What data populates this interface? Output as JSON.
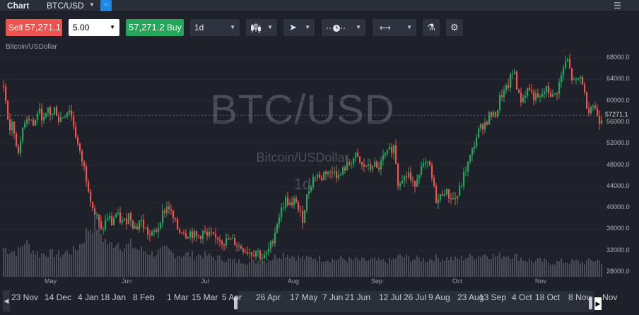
{
  "app": {
    "title": "Chart",
    "symbol": "BTC/USD"
  },
  "toolbar": {
    "sell_label": "Sell",
    "sell_price": "57,271.1",
    "quantity": "5.00",
    "buy_price": "57,271.2",
    "buy_label": "Buy",
    "interval": "1d"
  },
  "pair_label": "Bitcoin/USDollar",
  "watermark": {
    "symbol": "BTC/USD",
    "name": "Bitcoin/USDollar",
    "interval": "1d"
  },
  "colors": {
    "up": "#26a65b",
    "down": "#ef5350",
    "volume": "#4a4d55",
    "background": "#1e2129"
  },
  "last_price": "57271.1",
  "navigator_labels": [
    "23 Nov",
    "14 Dec",
    "4 Jan",
    "18 Jan",
    "8 Feb",
    "1 Mar",
    "15 Mar",
    "5 Apr",
    "26 Apr",
    "17 May",
    "7 Jun",
    "21 Jun",
    "12 Jul",
    "26 Jul",
    "9 Aug",
    "23 Aug",
    "13 Sep",
    "4 Oct",
    "18 Oct",
    "8 Nov",
    "Nov"
  ],
  "chart_data": {
    "type": "candlestick",
    "x_tick_labels": [
      "May",
      "Jun",
      "Jul",
      "Aug",
      "Sep",
      "Oct",
      "Nov"
    ],
    "y_tick_labels": [
      "68000.0",
      "64000.0",
      "60000.0",
      "56000.0",
      "52000.0",
      "48000.0",
      "44000.0",
      "40000.0",
      "36000.0",
      "32000.0",
      "28000.0"
    ],
    "ylim": [
      28000,
      70000
    ],
    "close_series": [
      {
        "t": 0,
        "v": 62800
      },
      {
        "t": 4,
        "v": 59000
      },
      {
        "t": 8,
        "v": 54500
      },
      {
        "t": 13,
        "v": 55500
      },
      {
        "t": 18,
        "v": 51800
      },
      {
        "t": 23,
        "v": 50500
      },
      {
        "t": 28,
        "v": 56000
      },
      {
        "t": 33,
        "v": 57000
      },
      {
        "t": 38,
        "v": 56800
      },
      {
        "t": 43,
        "v": 55000
      },
      {
        "t": 48,
        "v": 58000
      },
      {
        "t": 53,
        "v": 57500
      },
      {
        "t": 58,
        "v": 56000
      },
      {
        "t": 63,
        "v": 58500
      },
      {
        "t": 68,
        "v": 57000
      },
      {
        "t": 73,
        "v": 58800
      },
      {
        "t": 78,
        "v": 56500
      },
      {
        "t": 83,
        "v": 57000
      },
      {
        "t": 88,
        "v": 57800
      },
      {
        "t": 93,
        "v": 58500
      },
      {
        "t": 98,
        "v": 56000
      },
      {
        "t": 103,
        "v": 53000
      },
      {
        "t": 108,
        "v": 50000
      },
      {
        "t": 113,
        "v": 48000
      },
      {
        "t": 118,
        "v": 45000
      },
      {
        "t": 123,
        "v": 42000
      },
      {
        "t": 128,
        "v": 39000
      },
      {
        "t": 133,
        "v": 38000
      },
      {
        "t": 138,
        "v": 35500
      },
      {
        "t": 143,
        "v": 37000
      },
      {
        "t": 148,
        "v": 38500
      },
      {
        "t": 153,
        "v": 37000
      },
      {
        "t": 158,
        "v": 39000
      },
      {
        "t": 163,
        "v": 38000
      },
      {
        "t": 168,
        "v": 37200
      },
      {
        "t": 173,
        "v": 37500
      },
      {
        "t": 178,
        "v": 39000
      },
      {
        "t": 183,
        "v": 37000
      },
      {
        "t": 188,
        "v": 36000
      },
      {
        "t": 193,
        "v": 38000
      },
      {
        "t": 198,
        "v": 36500
      },
      {
        "t": 203,
        "v": 35500
      },
      {
        "t": 208,
        "v": 34500
      },
      {
        "t": 213,
        "v": 35500
      },
      {
        "t": 218,
        "v": 36000
      },
      {
        "t": 223,
        "v": 38500
      },
      {
        "t": 228,
        "v": 39500
      },
      {
        "t": 233,
        "v": 40500
      },
      {
        "t": 238,
        "v": 38500
      },
      {
        "t": 243,
        "v": 37000
      },
      {
        "t": 248,
        "v": 35500
      },
      {
        "t": 253,
        "v": 36000
      },
      {
        "t": 258,
        "v": 35000
      },
      {
        "t": 263,
        "v": 35500
      },
      {
        "t": 268,
        "v": 35000
      },
      {
        "t": 273,
        "v": 34500
      },
      {
        "t": 278,
        "v": 34800
      },
      {
        "t": 283,
        "v": 35500
      },
      {
        "t": 288,
        "v": 34500
      },
      {
        "t": 293,
        "v": 35000
      },
      {
        "t": 298,
        "v": 34000
      },
      {
        "t": 303,
        "v": 34500
      },
      {
        "t": 308,
        "v": 34000
      },
      {
        "t": 313,
        "v": 33500
      },
      {
        "t": 318,
        "v": 34000
      },
      {
        "t": 323,
        "v": 33800
      },
      {
        "t": 328,
        "v": 33500
      },
      {
        "t": 333,
        "v": 32800
      },
      {
        "t": 338,
        "v": 32500
      },
      {
        "t": 343,
        "v": 32000
      },
      {
        "t": 348,
        "v": 31800
      },
      {
        "t": 353,
        "v": 31500
      },
      {
        "t": 358,
        "v": 32200
      },
      {
        "t": 363,
        "v": 31000
      },
      {
        "t": 368,
        "v": 30500
      },
      {
        "t": 373,
        "v": 31500
      },
      {
        "t": 378,
        "v": 33000
      },
      {
        "t": 383,
        "v": 35000
      },
      {
        "t": 388,
        "v": 38000
      },
      {
        "t": 393,
        "v": 39500
      },
      {
        "t": 398,
        "v": 41500
      },
      {
        "t": 403,
        "v": 41000
      },
      {
        "t": 408,
        "v": 40000
      },
      {
        "t": 413,
        "v": 42000
      },
      {
        "t": 418,
        "v": 39000
      },
      {
        "t": 423,
        "v": 38000
      },
      {
        "t": 428,
        "v": 41500
      },
      {
        "t": 433,
        "v": 44000
      },
      {
        "t": 438,
        "v": 45500
      },
      {
        "t": 443,
        "v": 46500
      },
      {
        "t": 448,
        "v": 45000
      },
      {
        "t": 453,
        "v": 46500
      },
      {
        "t": 458,
        "v": 47000
      },
      {
        "t": 463,
        "v": 46000
      },
      {
        "t": 468,
        "v": 47500
      },
      {
        "t": 473,
        "v": 45500
      },
      {
        "t": 478,
        "v": 46500
      },
      {
        "t": 483,
        "v": 47500
      },
      {
        "t": 488,
        "v": 48000
      },
      {
        "t": 493,
        "v": 49000
      },
      {
        "t": 498,
        "v": 49500
      },
      {
        "t": 503,
        "v": 48500
      },
      {
        "t": 508,
        "v": 47500
      },
      {
        "t": 513,
        "v": 48000
      },
      {
        "t": 518,
        "v": 47000
      },
      {
        "t": 523,
        "v": 48500
      },
      {
        "t": 528,
        "v": 47000
      },
      {
        "t": 533,
        "v": 48000
      },
      {
        "t": 538,
        "v": 49500
      },
      {
        "t": 543,
        "v": 50000
      },
      {
        "t": 548,
        "v": 51000
      },
      {
        "t": 553,
        "v": 51500
      },
      {
        "t": 558,
        "v": 44500
      },
      {
        "t": 563,
        "v": 46000
      },
      {
        "t": 568,
        "v": 45500
      },
      {
        "t": 573,
        "v": 46500
      },
      {
        "t": 578,
        "v": 44000
      },
      {
        "t": 583,
        "v": 45000
      },
      {
        "t": 588,
        "v": 47000
      },
      {
        "t": 593,
        "v": 47500
      },
      {
        "t": 598,
        "v": 48000
      },
      {
        "t": 603,
        "v": 47500
      },
      {
        "t": 608,
        "v": 44000
      },
      {
        "t": 613,
        "v": 41000
      },
      {
        "t": 618,
        "v": 42000
      },
      {
        "t": 623,
        "v": 43500
      },
      {
        "t": 628,
        "v": 42500
      },
      {
        "t": 633,
        "v": 42000
      },
      {
        "t": 638,
        "v": 41500
      },
      {
        "t": 643,
        "v": 42500
      },
      {
        "t": 648,
        "v": 44500
      },
      {
        "t": 653,
        "v": 47000
      },
      {
        "t": 658,
        "v": 48500
      },
      {
        "t": 663,
        "v": 50500
      },
      {
        "t": 668,
        "v": 53000
      },
      {
        "t": 673,
        "v": 54500
      },
      {
        "t": 678,
        "v": 55500
      },
      {
        "t": 683,
        "v": 56000
      },
      {
        "t": 688,
        "v": 57500
      },
      {
        "t": 693,
        "v": 57000
      },
      {
        "t": 698,
        "v": 58000
      },
      {
        "t": 703,
        "v": 61000
      },
      {
        "t": 708,
        "v": 61500
      },
      {
        "t": 713,
        "v": 62500
      },
      {
        "t": 718,
        "v": 64500
      },
      {
        "t": 723,
        "v": 65500
      },
      {
        "t": 728,
        "v": 61000
      },
      {
        "t": 733,
        "v": 60000
      },
      {
        "t": 738,
        "v": 61500
      },
      {
        "t": 743,
        "v": 62500
      },
      {
        "t": 748,
        "v": 61000
      },
      {
        "t": 753,
        "v": 60500
      },
      {
        "t": 758,
        "v": 60000
      },
      {
        "t": 763,
        "v": 61500
      },
      {
        "t": 768,
        "v": 62000
      },
      {
        "t": 773,
        "v": 61500
      },
      {
        "t": 778,
        "v": 60500
      },
      {
        "t": 783,
        "v": 62000
      },
      {
        "t": 788,
        "v": 64000
      },
      {
        "t": 793,
        "v": 66500
      },
      {
        "t": 798,
        "v": 67500
      },
      {
        "t": 803,
        "v": 64500
      },
      {
        "t": 808,
        "v": 63000
      },
      {
        "t": 813,
        "v": 64000
      },
      {
        "t": 818,
        "v": 64500
      },
      {
        "t": 823,
        "v": 60000
      },
      {
        "t": 828,
        "v": 58500
      },
      {
        "t": 833,
        "v": 59500
      },
      {
        "t": 838,
        "v": 58000
      },
      {
        "t": 843,
        "v": 56500
      },
      {
        "t": 848,
        "v": 57271
      }
    ],
    "volume_series": [
      {
        "t": 0,
        "v": 0.45
      },
      {
        "t": 10,
        "v": 0.4
      },
      {
        "t": 20,
        "v": 0.38
      },
      {
        "t": 30,
        "v": 0.55
      },
      {
        "t": 40,
        "v": 0.42
      },
      {
        "t": 50,
        "v": 0.35
      },
      {
        "t": 60,
        "v": 0.37
      },
      {
        "t": 70,
        "v": 0.36
      },
      {
        "t": 80,
        "v": 0.34
      },
      {
        "t": 90,
        "v": 0.38
      },
      {
        "t": 100,
        "v": 0.4
      },
      {
        "t": 110,
        "v": 0.52
      },
      {
        "t": 120,
        "v": 0.75
      },
      {
        "t": 130,
        "v": 0.85
      },
      {
        "t": 140,
        "v": 0.62
      },
      {
        "t": 150,
        "v": 0.48
      },
      {
        "t": 160,
        "v": 0.55
      },
      {
        "t": 170,
        "v": 0.45
      },
      {
        "t": 180,
        "v": 0.5
      },
      {
        "t": 190,
        "v": 0.42
      },
      {
        "t": 200,
        "v": 0.4
      },
      {
        "t": 210,
        "v": 0.36
      },
      {
        "t": 220,
        "v": 0.38
      },
      {
        "t": 230,
        "v": 0.42
      },
      {
        "t": 240,
        "v": 0.36
      },
      {
        "t": 250,
        "v": 0.34
      },
      {
        "t": 260,
        "v": 0.35
      },
      {
        "t": 270,
        "v": 0.33
      },
      {
        "t": 280,
        "v": 0.34
      },
      {
        "t": 290,
        "v": 0.32
      },
      {
        "t": 300,
        "v": 0.3
      },
      {
        "t": 310,
        "v": 0.28
      },
      {
        "t": 320,
        "v": 0.26
      },
      {
        "t": 330,
        "v": 0.24
      },
      {
        "t": 340,
        "v": 0.24
      },
      {
        "t": 350,
        "v": 0.22
      },
      {
        "t": 360,
        "v": 0.24
      },
      {
        "t": 370,
        "v": 0.26
      },
      {
        "t": 380,
        "v": 0.28
      },
      {
        "t": 390,
        "v": 0.34
      },
      {
        "t": 400,
        "v": 0.36
      },
      {
        "t": 410,
        "v": 0.32
      },
      {
        "t": 420,
        "v": 0.3
      },
      {
        "t": 430,
        "v": 0.28
      },
      {
        "t": 440,
        "v": 0.3
      },
      {
        "t": 450,
        "v": 0.28
      },
      {
        "t": 460,
        "v": 0.27
      },
      {
        "t": 470,
        "v": 0.27
      },
      {
        "t": 480,
        "v": 0.28
      },
      {
        "t": 490,
        "v": 0.26
      },
      {
        "t": 500,
        "v": 0.26
      },
      {
        "t": 510,
        "v": 0.25
      },
      {
        "t": 520,
        "v": 0.26
      },
      {
        "t": 530,
        "v": 0.25
      },
      {
        "t": 540,
        "v": 0.24
      },
      {
        "t": 550,
        "v": 0.26
      },
      {
        "t": 560,
        "v": 0.32
      },
      {
        "t": 570,
        "v": 0.3
      },
      {
        "t": 580,
        "v": 0.27
      },
      {
        "t": 590,
        "v": 0.28
      },
      {
        "t": 600,
        "v": 0.26
      },
      {
        "t": 610,
        "v": 0.3
      },
      {
        "t": 620,
        "v": 0.28
      },
      {
        "t": 630,
        "v": 0.29
      },
      {
        "t": 640,
        "v": 0.27
      },
      {
        "t": 650,
        "v": 0.29
      },
      {
        "t": 660,
        "v": 0.31
      },
      {
        "t": 670,
        "v": 0.33
      },
      {
        "t": 680,
        "v": 0.35
      },
      {
        "t": 690,
        "v": 0.33
      },
      {
        "t": 700,
        "v": 0.32
      },
      {
        "t": 710,
        "v": 0.34
      },
      {
        "t": 720,
        "v": 0.33
      },
      {
        "t": 730,
        "v": 0.3
      },
      {
        "t": 740,
        "v": 0.26
      },
      {
        "t": 750,
        "v": 0.24
      },
      {
        "t": 760,
        "v": 0.25
      },
      {
        "t": 770,
        "v": 0.23
      },
      {
        "t": 780,
        "v": 0.22
      },
      {
        "t": 790,
        "v": 0.24
      },
      {
        "t": 800,
        "v": 0.23
      },
      {
        "t": 810,
        "v": 0.24
      },
      {
        "t": 820,
        "v": 0.22
      },
      {
        "t": 830,
        "v": 0.25
      },
      {
        "t": 840,
        "v": 0.26
      },
      {
        "t": 848,
        "v": 0.22
      }
    ]
  }
}
